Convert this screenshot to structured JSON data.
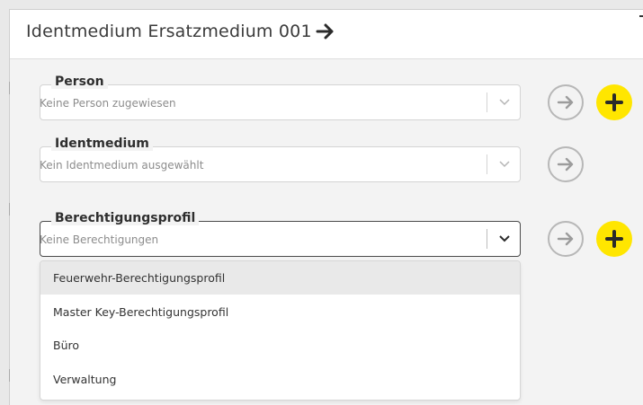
{
  "header": {
    "title": "Identmedium Ersatzmedium 001",
    "arrow_icon": "arrow-right-icon"
  },
  "fields": {
    "person": {
      "label": "Person",
      "placeholder": "Keine Person zugewiesen"
    },
    "identmedium": {
      "label": "Identmedium",
      "placeholder": "Kein Identmedium ausgewählt"
    },
    "berechtigungsprofil": {
      "label": "Berechtigungsprofil",
      "placeholder": "Keine Berechtigungen"
    }
  },
  "dropdown": {
    "options": [
      "Feuerwehr-Berechtigungsprofil",
      "Master Key-Berechtigungsprofil",
      "Büro",
      "Verwaltung"
    ],
    "highlighted_index": 0
  },
  "colors": {
    "accent_yellow": "#ffe600",
    "icon_gray": "#b7b7b7",
    "background": "#f3f3f3"
  }
}
